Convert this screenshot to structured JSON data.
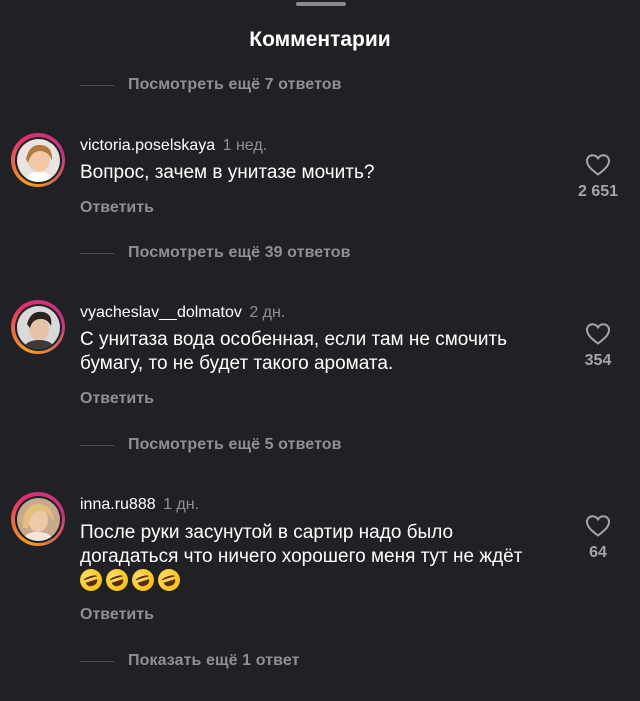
{
  "header": {
    "title": "Комментарии"
  },
  "replies_links": {
    "top": "Посмотреть ещё 7 ответов",
    "after_1": "Посмотреть ещё 39 ответов",
    "after_2": "Посмотреть ещё 5 ответов",
    "after_3": "Показать ещё 1 ответ"
  },
  "comments": [
    {
      "username": "victoria.poselskaya",
      "time": "1 нед.",
      "text": "Вопрос, зачем в унитазе мочить?",
      "reply_label": "Ответить",
      "likes": "2 651"
    },
    {
      "username": "vyacheslav__dolmatov",
      "time": "2 дн.",
      "text": "С унитаза вода особенная, если там не смочить бумагу, то не будет такого аромата.",
      "reply_label": "Ответить",
      "likes": "354"
    },
    {
      "username": "inna.ru888",
      "time": "1 дн.",
      "text": "После руки засунутой в сартир надо было догадаться что ничего хорошего меня тут не ждёт",
      "emoji_icons": [
        "rolling-on-floor-laughing",
        "rolling-on-floor-laughing",
        "rolling-on-floor-laughing",
        "rolling-on-floor-laughing"
      ],
      "reply_label": "Ответить",
      "likes": "64"
    }
  ],
  "icons": {
    "like": "heart-outline-icon"
  },
  "colors": {
    "background": "#202124",
    "muted": "#8e9096",
    "text": "#ffffff"
  }
}
